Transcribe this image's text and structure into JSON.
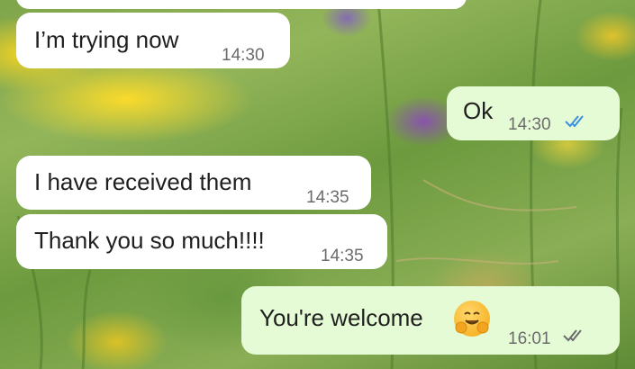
{
  "messages": [
    {
      "id": "m1",
      "direction": "incoming",
      "text": "I’m trying now",
      "time": "14:30"
    },
    {
      "id": "m2",
      "direction": "outgoing",
      "text": "Ok",
      "time": "14:30",
      "status": "read",
      "status_color": "#3d8fe0"
    },
    {
      "id": "m3",
      "direction": "incoming",
      "text": "I have received them",
      "time": "14:35"
    },
    {
      "id": "m4",
      "direction": "incoming",
      "text": "Thank you so much!!!!",
      "time": "14:35"
    },
    {
      "id": "m5",
      "direction": "outgoing",
      "text": "You're welcome",
      "emoji": "hugging-face",
      "time": "16:01",
      "status": "delivered",
      "status_color": "#6b6b6b"
    }
  ],
  "colors": {
    "incoming_bubble": "#ffffff",
    "outgoing_bubble": "#e5fbd6",
    "text": "#1f1f1f",
    "time": "#6b6b6b"
  }
}
